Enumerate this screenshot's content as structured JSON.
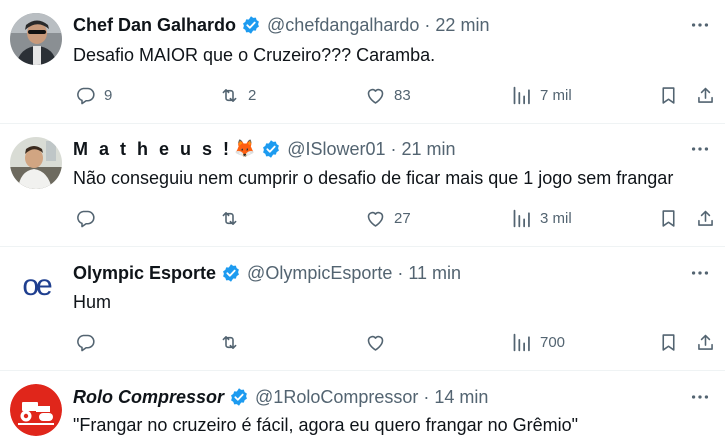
{
  "tweets": [
    {
      "name": "Chef Dan Galhardo",
      "handle": "@chefdangalhardo",
      "separator": "·",
      "time": "22 min",
      "text": "Desafio MAIOR que o Cruzeiro??? Caramba.",
      "replies": "9",
      "retweets": "2",
      "likes": "83",
      "views": "7 mil"
    },
    {
      "name": "M a t h e u s !",
      "emoji": "🦊",
      "handle": "@ISlower01",
      "separator": "·",
      "time": "21 min",
      "text": "Não conseguiu nem cumprir o desafio de ficar mais que 1 jogo sem frangar",
      "replies": "",
      "retweets": "",
      "likes": "27",
      "views": "3 mil"
    },
    {
      "name": "Olympic Esporte",
      "handle": "@OlympicEsporte",
      "separator": "·",
      "time": "11 min",
      "text": "Hum",
      "avatar_text": "oe",
      "replies": "",
      "retweets": "",
      "likes": "",
      "views": "700"
    },
    {
      "name": "Rolo Compressor",
      "handle": "@1RoloCompressor",
      "separator": "·",
      "time": "14 min",
      "text": "\"Frangar no cruzeiro é fácil, agora eu quero frangar no Grêmio\""
    }
  ],
  "colors": {
    "verified": "#1d9bf0",
    "muted": "#536471",
    "divider": "#eff3f4",
    "olympic_logo": "#1f3f8f",
    "rolo_red": "#e0261b"
  },
  "icons": [
    "verified-badge-icon",
    "more-icon",
    "reply-icon",
    "retweet-icon",
    "like-icon",
    "views-icon",
    "bookmark-icon",
    "share-icon"
  ]
}
